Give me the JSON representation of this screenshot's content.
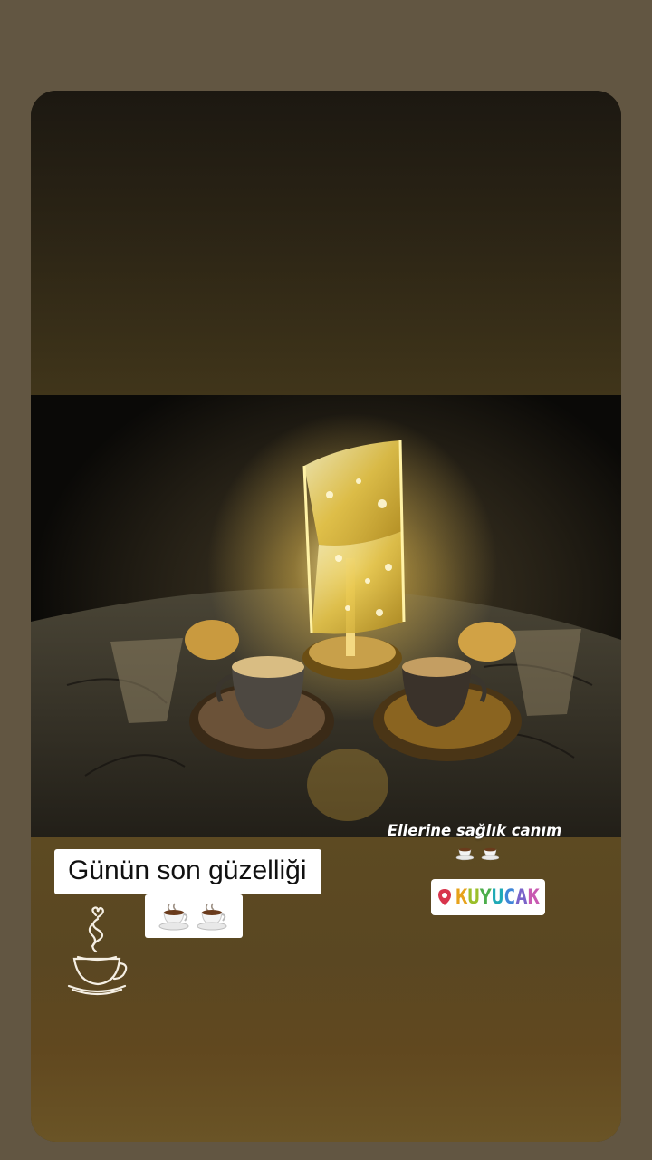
{
  "story": {
    "caption_main": "Günün son güzelliği",
    "caption_right": "Ellerine sağlık canım",
    "location": "KUYUCAK",
    "location_colors": [
      "#e7a21b",
      "#9bbf2a",
      "#4cae4c",
      "#1fa9b6",
      "#3f86d8",
      "#7a63c9",
      "#c859b1"
    ]
  },
  "icons": {
    "caption_cups": [
      "coffee-cup-icon",
      "coffee-cup-icon"
    ],
    "location_pin": "location-pin-icon",
    "decorative_sticker": "steaming-coffee-cup-icon"
  },
  "colors": {
    "background": "#625642",
    "sticker_white": "#ffffff",
    "pin_red": "#d8344c"
  }
}
